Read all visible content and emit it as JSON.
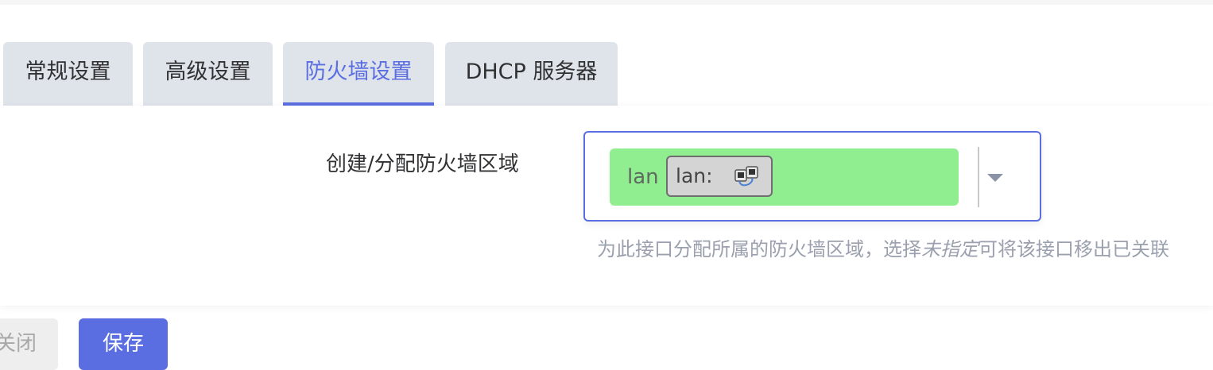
{
  "tabs": [
    {
      "label": "常规设置",
      "active": false
    },
    {
      "label": "高级设置",
      "active": false
    },
    {
      "label": "防火墙设置",
      "active": true
    },
    {
      "label": "DHCP 服务器",
      "active": false
    }
  ],
  "firewall": {
    "field_label": "创建/分配防火墙区域",
    "selected_zone": "lan",
    "zone_color": "#90ee90",
    "interface_label": "lan:",
    "interface_icon": "network-ports-icon",
    "hint_prefix": "为此接口分配所属的防火墙区域，选择",
    "hint_emphasis": "未指定",
    "hint_suffix": "可将该接口移出已关联"
  },
  "buttons": {
    "close": "关闭",
    "save": "保存"
  },
  "colors": {
    "accent": "#5b6ee1",
    "tab_bg": "#dfe3ea"
  }
}
